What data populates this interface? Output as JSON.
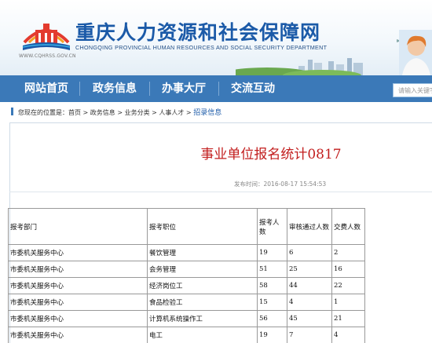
{
  "header": {
    "title": "重庆人力资源和社会保障网",
    "subtitle": "CHONGQING PROVINCIAL HUMAN RESOURCES AND SOCIAL SECURITY DEPARTMENT",
    "url": "WWW.CQHRSS.GOV.CN"
  },
  "nav": {
    "items": [
      "网站首页",
      "政务信息",
      "办事大厅",
      "交流互动"
    ],
    "search_placeholder": "请输入关键字"
  },
  "breadcrumb": {
    "prefix": "您现在的位置是：",
    "items": [
      "首页",
      "政务信息",
      "业务分类",
      "人事人才"
    ],
    "current": "招录信息",
    "sep": " > "
  },
  "article": {
    "title": "事业单位报名统计0817",
    "publish": "发布时间：2016-08-17 15:54:53"
  },
  "table": {
    "headers": [
      "报考部门",
      "报考职位",
      "报考人数",
      "审核通过人数",
      "交费人数"
    ],
    "rows": [
      [
        "市委机关服务中心",
        "餐饮管理",
        "19",
        "6",
        "2"
      ],
      [
        "市委机关服务中心",
        "会务管理",
        "51",
        "25",
        "16"
      ],
      [
        "市委机关服务中心",
        "经济岗位工",
        "58",
        "44",
        "22"
      ],
      [
        "市委机关服务中心",
        "食品检验工",
        "15",
        "4",
        "1"
      ],
      [
        "市委机关服务中心",
        "计算机系统操作工",
        "56",
        "45",
        "21"
      ],
      [
        "市委机关服务中心",
        "电工",
        "19",
        "7",
        "4"
      ]
    ]
  }
}
